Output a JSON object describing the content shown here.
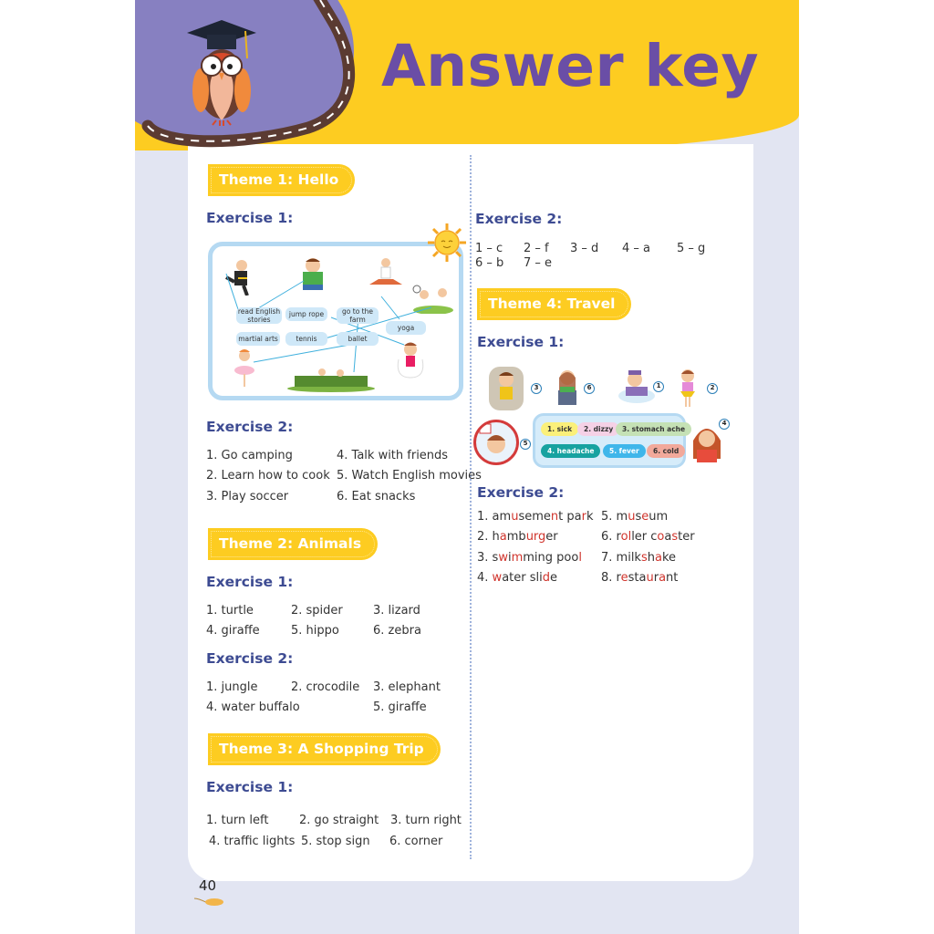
{
  "header": {
    "title": "Answer key"
  },
  "themes": [
    {
      "label": "Theme 1: Hello",
      "exercises": [
        {
          "title": "Exercise 1:",
          "activity_tags": [
            "read English stories",
            "jump rope",
            "go to the farm",
            "yoga",
            "martial arts",
            "tennis",
            "ballet"
          ]
        },
        {
          "title": "Exercise 2:",
          "answers": [
            "1. Go camping",
            "2. Learn how to cook",
            "3. Play soccer",
            "4. Talk with friends",
            "5. Watch English movies",
            "6. Eat snacks"
          ]
        },
        {
          "title": "Exercise 2:",
          "answers": [
            "1 – c",
            "2 – f",
            "3 – d",
            "4 – a",
            "5 – g",
            "6 – b",
            "7 – e"
          ]
        }
      ]
    },
    {
      "label": "Theme 2: Animals",
      "exercises": [
        {
          "title": "Exercise 1:",
          "answers": [
            "1. turtle",
            "2. spider",
            "3. lizard",
            "4. giraffe",
            "5. hippo",
            "6. zebra"
          ]
        },
        {
          "title": "Exercise 2:",
          "answers": [
            "1. jungle",
            "2. crocodile",
            "3. elephant",
            "4. water buffalo",
            "5. giraffe"
          ]
        }
      ]
    },
    {
      "label": "Theme 3: A Shopping Trip",
      "exercises": [
        {
          "title": "Exercise 1:",
          "answers": [
            "1. turn left",
            "2. go straight",
            "3. turn right",
            "4. traffic lights",
            "5. stop sign",
            "6. corner"
          ]
        }
      ]
    },
    {
      "label": "Theme 4: Travel",
      "exercises": [
        {
          "title": "Exercise 1:",
          "chips": [
            "1. sick",
            "2. dizzy",
            "3. stomach ache",
            "4. headache",
            "5. fever",
            "6. cold"
          ],
          "picture_numbers": [
            "3",
            "6",
            "1",
            "2",
            "5",
            "4"
          ]
        },
        {
          "title": "Exercise 2:",
          "answers": [
            {
              "num": "1. ",
              "parts": [
                [
                  "am",
                  0
                ],
                [
                  "u",
                  1
                ],
                [
                  "seme",
                  0
                ],
                [
                  "n",
                  1
                ],
                [
                  "t pa",
                  0
                ],
                [
                  "r",
                  1
                ],
                [
                  "k",
                  0
                ]
              ]
            },
            {
              "num": "2. ",
              "parts": [
                [
                  "h",
                  0
                ],
                [
                  "a",
                  1
                ],
                [
                  "mb",
                  0
                ],
                [
                  "urg",
                  1
                ],
                [
                  "er",
                  0
                ]
              ]
            },
            {
              "num": "3. ",
              "parts": [
                [
                  "s",
                  0
                ],
                [
                  "w",
                  1
                ],
                [
                  "i",
                  0
                ],
                [
                  "m",
                  1
                ],
                [
                  "ming poo",
                  0
                ],
                [
                  "l",
                  1
                ]
              ]
            },
            {
              "num": "4. ",
              "parts": [
                [
                  "w",
                  1
                ],
                [
                  "ater sli",
                  0
                ],
                [
                  "d",
                  1
                ],
                [
                  "e",
                  0
                ]
              ]
            },
            {
              "num": "5. ",
              "parts": [
                [
                  "m",
                  0
                ],
                [
                  "u",
                  1
                ],
                [
                  "s",
                  0
                ],
                [
                  "e",
                  1
                ],
                [
                  "um",
                  0
                ]
              ]
            },
            {
              "num": "6. ",
              "parts": [
                [
                  "r",
                  0
                ],
                [
                  "ol",
                  1
                ],
                [
                  "ler c",
                  0
                ],
                [
                  "o",
                  1
                ],
                [
                  "a",
                  0
                ],
                [
                  "s",
                  1
                ],
                [
                  "ter",
                  0
                ]
              ]
            },
            {
              "num": "7. ",
              "parts": [
                [
                  "milk",
                  0
                ],
                [
                  "s",
                  1
                ],
                [
                  "h",
                  0
                ],
                [
                  "a",
                  1
                ],
                [
                  "ke",
                  0
                ]
              ]
            },
            {
              "num": "8. ",
              "parts": [
                [
                  "r",
                  0
                ],
                [
                  "e",
                  1
                ],
                [
                  "sta",
                  0
                ],
                [
                  "u",
                  1
                ],
                [
                  "r",
                  0
                ],
                [
                  "a",
                  1
                ],
                [
                  "nt",
                  0
                ]
              ]
            }
          ]
        }
      ]
    }
  ],
  "footer": {
    "page_number": "40"
  },
  "colors": {
    "accent_yellow": "#fdcc21",
    "title_purple": "#6a4ea6",
    "heading_blue": "#3d4b92",
    "highlight_red": "#d0342c",
    "blob_purple": "#8780c1"
  }
}
